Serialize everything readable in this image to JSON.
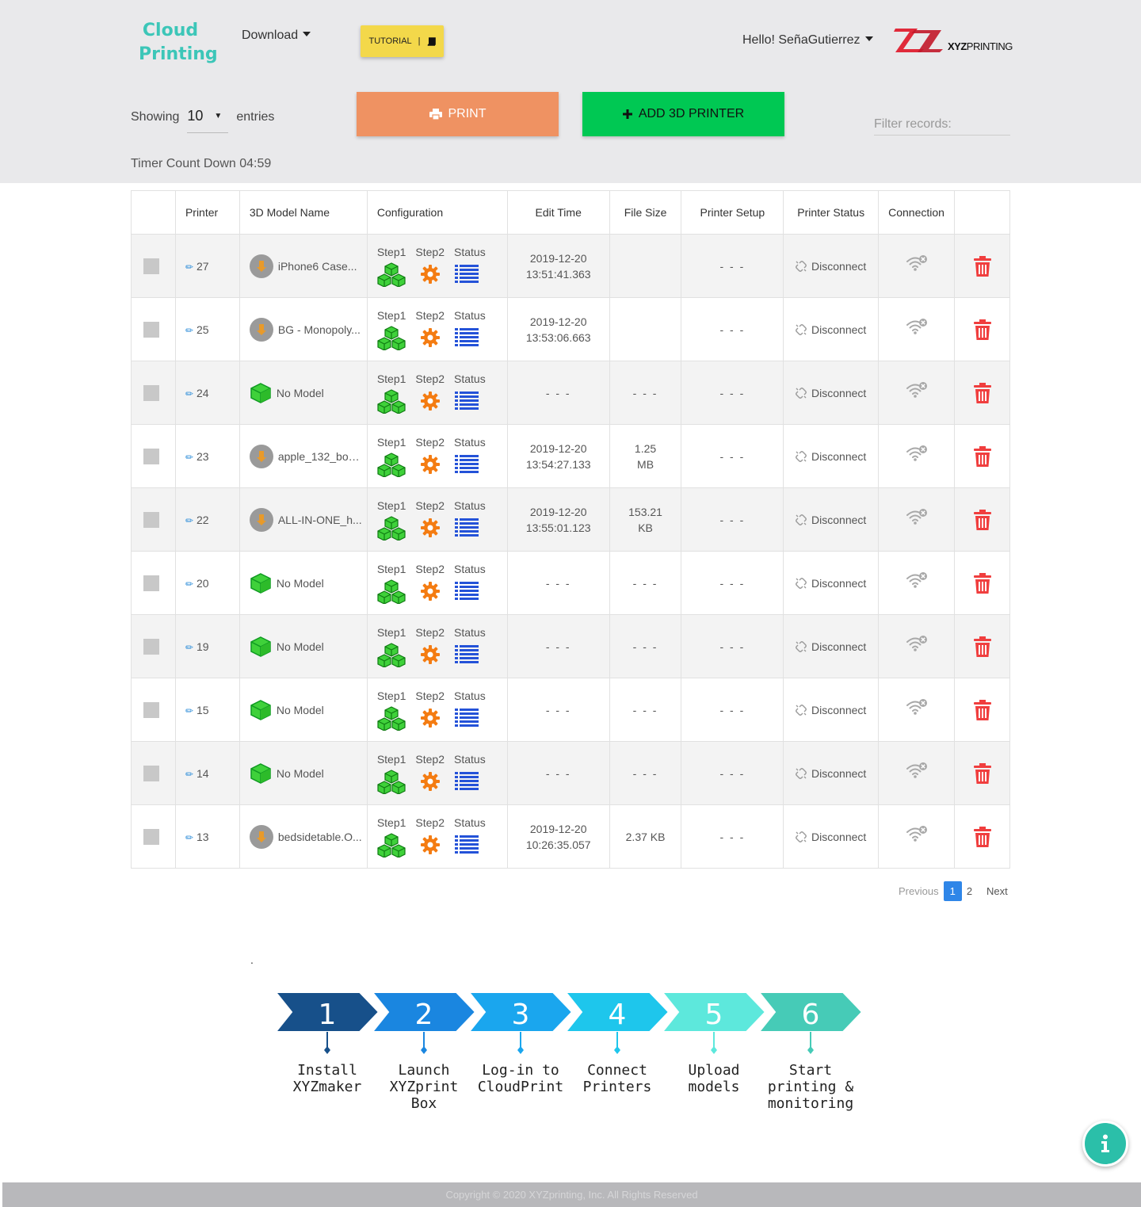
{
  "header": {
    "logo_line1": "Cloud",
    "logo_line2": "Printing",
    "download_label": "Download",
    "tutorial_label": "TUTORIAL",
    "tutorial_sep": "|",
    "greeting": "Hello! SeñaGutierrez",
    "brand_bold": "XYZ",
    "brand_rest": "PRINTING"
  },
  "toolbar": {
    "showing_label": "Showing",
    "entries_value": "10",
    "entries_label": "entries",
    "print_label": "PRINT",
    "add_label": "ADD 3D PRINTER",
    "filter_placeholder": "Filter records:",
    "timer": "Timer Count Down 04:59"
  },
  "table": {
    "columns": [
      "",
      "Printer",
      "3D Model Name",
      "Configuration",
      "Edit Time",
      "File Size",
      "Printer Setup",
      "Printer Status",
      "Connection",
      ""
    ],
    "cfg_labels": [
      "Step1",
      "Step2",
      "Status"
    ],
    "rows": [
      {
        "printer": "27",
        "model": "iPhone6 Case...",
        "model_icon": "thumbnail",
        "edit_date": "2019-12-20",
        "edit_time": "13:51:41.363",
        "size1": "",
        "size2": "",
        "setup": "- - -",
        "status": "Disconnect"
      },
      {
        "printer": "25",
        "model": "BG - Monopoly...",
        "model_icon": "thumbnail",
        "edit_date": "2019-12-20",
        "edit_time": "13:53:06.663",
        "size1": "",
        "size2": "",
        "setup": "- - -",
        "status": "Disconnect"
      },
      {
        "printer": "24",
        "model": "No Model",
        "model_icon": "cube",
        "edit_date": "- - -",
        "edit_time": "",
        "size1": "- - -",
        "size2": "",
        "setup": "- - -",
        "status": "Disconnect"
      },
      {
        "printer": "23",
        "model": "apple_132_bod...",
        "model_icon": "thumbnail",
        "edit_date": "2019-12-20",
        "edit_time": "13:54:27.133",
        "size1": "1.25",
        "size2": "MB",
        "setup": "- - -",
        "status": "Disconnect"
      },
      {
        "printer": "22",
        "model": "ALL-IN-ONE_h...",
        "model_icon": "thumbnail",
        "edit_date": "2019-12-20",
        "edit_time": "13:55:01.123",
        "size1": "153.21",
        "size2": "KB",
        "setup": "- - -",
        "status": "Disconnect"
      },
      {
        "printer": "20",
        "model": "No Model",
        "model_icon": "cube",
        "edit_date": "- - -",
        "edit_time": "",
        "size1": "- - -",
        "size2": "",
        "setup": "- - -",
        "status": "Disconnect"
      },
      {
        "printer": "19",
        "model": "No Model",
        "model_icon": "cube",
        "edit_date": "- - -",
        "edit_time": "",
        "size1": "- - -",
        "size2": "",
        "setup": "- - -",
        "status": "Disconnect"
      },
      {
        "printer": "15",
        "model": "No Model",
        "model_icon": "cube",
        "edit_date": "- - -",
        "edit_time": "",
        "size1": "- - -",
        "size2": "",
        "setup": "- - -",
        "status": "Disconnect"
      },
      {
        "printer": "14",
        "model": "No Model",
        "model_icon": "cube",
        "edit_date": "- - -",
        "edit_time": "",
        "size1": "- - -",
        "size2": "",
        "setup": "- - -",
        "status": "Disconnect"
      },
      {
        "printer": "13",
        "model": "bedsidetable.O...",
        "model_icon": "thumbnail",
        "edit_date": "2019-12-20",
        "edit_time": "10:26:35.057",
        "size1": "2.37 KB",
        "size2": "",
        "setup": "- - -",
        "status": "Disconnect"
      }
    ]
  },
  "pagination": {
    "previous": "Previous",
    "pages": [
      "1",
      "2"
    ],
    "active": "1",
    "next": "Next"
  },
  "dot": ".",
  "steps": [
    {
      "num": "1",
      "label": "Install XYZmaker",
      "color": "#17508a"
    },
    {
      "num": "2",
      "label": "Launch XYZprint Box",
      "color": "#1a86e0"
    },
    {
      "num": "3",
      "label": "Log-in to CloudPrint",
      "color": "#1aa6ee"
    },
    {
      "num": "4",
      "label": "Connect Printers",
      "color": "#1ec6ec"
    },
    {
      "num": "5",
      "label": "Upload models",
      "color": "#5de8dc"
    },
    {
      "num": "6",
      "label": "Start printing & monitoring",
      "color": "#46cbb7"
    }
  ],
  "colors": {
    "accent": "#3cc6b8",
    "print_button": "#ef9262",
    "add_button": "#00c853",
    "tutorial": "#f3d84a",
    "delete": "#f03e3e"
  },
  "footer": {
    "copyright": "Copyright ©  2020  XYZprinting, Inc. All Rights Reserved"
  }
}
